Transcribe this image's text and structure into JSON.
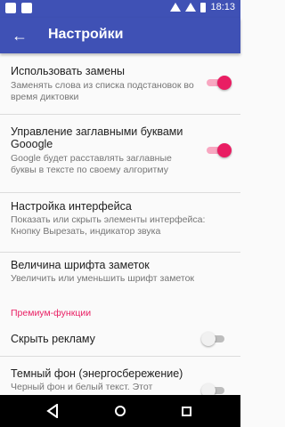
{
  "status_bar": {
    "time": "18:13"
  },
  "app_bar": {
    "title": "Настройки"
  },
  "settings": {
    "replacements": {
      "title": "Использовать замены",
      "subtitle": "Заменять слова из списка подстановок во время диктовки",
      "enabled": true
    },
    "capitalization": {
      "title": "Управление заглавными буквами Gooogle",
      "subtitle": "Google будет расставлять заглавные буквы в тексте по своему алгоритму",
      "enabled": true
    },
    "interface": {
      "title": "Настройка интерфейса",
      "subtitle": "Показать или скрыть элементы интерфейса: Кнопку Вырезать, индикатор звука"
    },
    "font_size": {
      "title": "Величина шрифта заметок",
      "subtitle": "Увеличить или уменьшить шрифт заметок"
    },
    "premium_header": "Премиум-функции",
    "hide_ads": {
      "title": "Скрыть рекламу",
      "enabled": false
    },
    "dark_bg": {
      "title": "Темный фон (энергосбережение)",
      "subtitle": "Черный фон и белый текст. Этот",
      "enabled": false
    }
  },
  "colors": {
    "primary": "#3f51b5",
    "accent": "#e91e63"
  }
}
